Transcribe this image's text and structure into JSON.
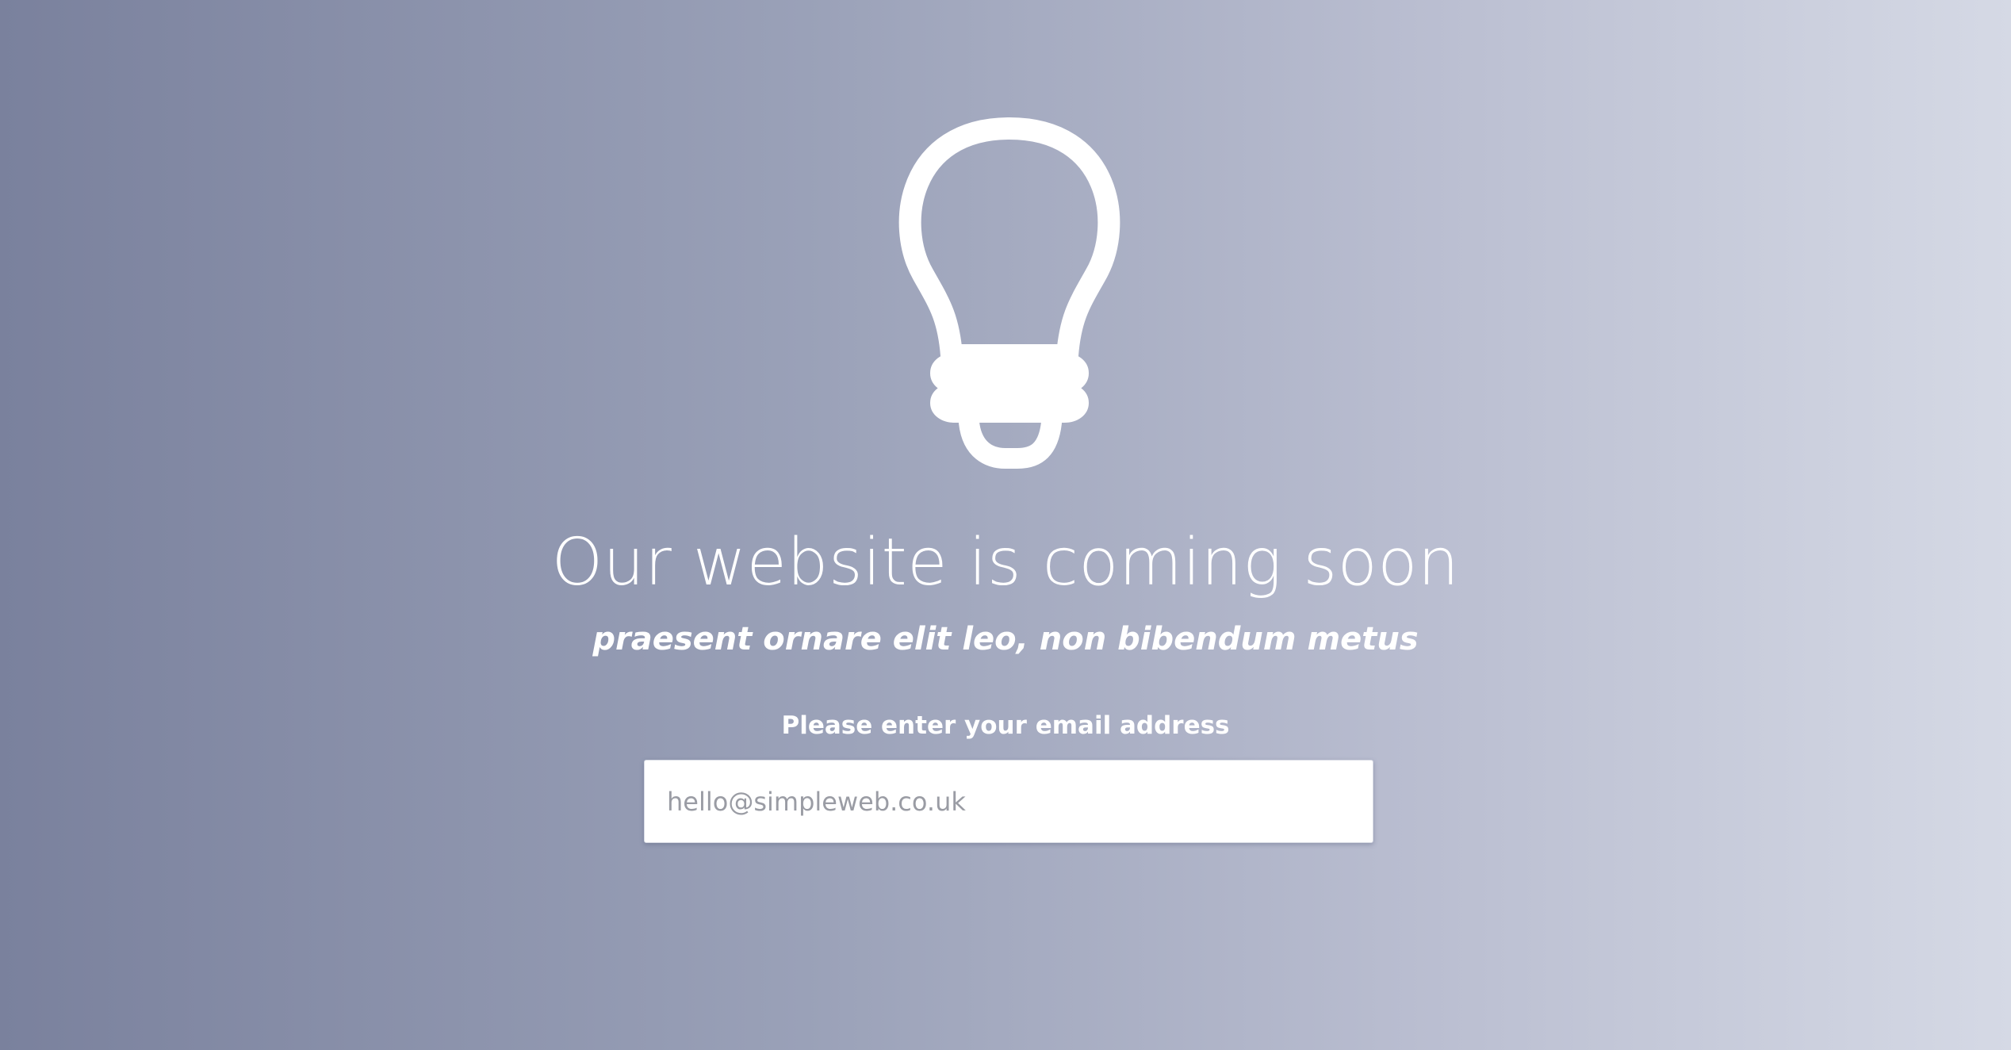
{
  "hero": {
    "icon": "lightbulb-icon",
    "title": "Our website is coming soon",
    "subtitle": "praesent ornare elit leo, non bibendum metus"
  },
  "signup": {
    "label": "Please enter your email address",
    "email_placeholder": "hello@simpleweb.co.uk",
    "email_value": ""
  },
  "colors": {
    "background_start": "#7a819d",
    "background_end": "#d5d9e5",
    "text": "#ffffff"
  }
}
